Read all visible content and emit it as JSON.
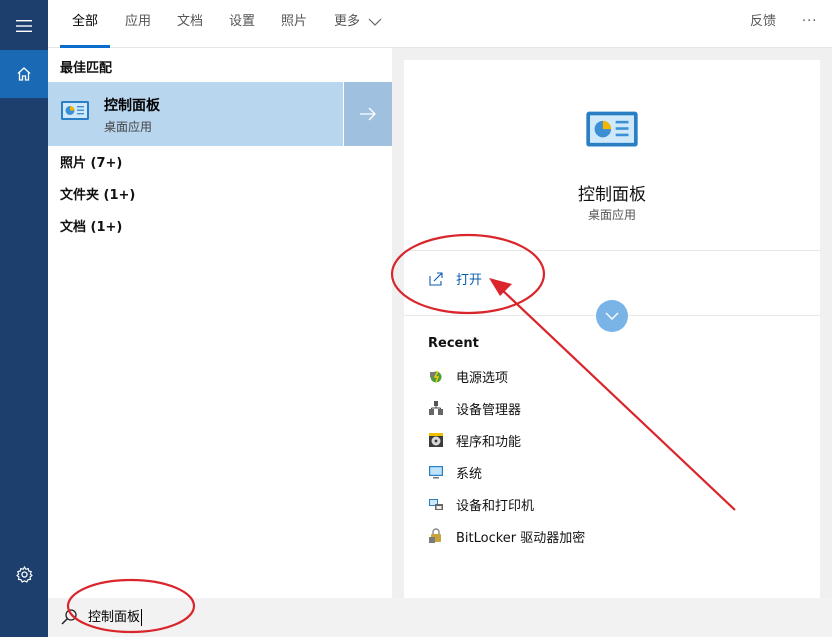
{
  "rail": {
    "items": [
      {
        "name": "menu",
        "icon": "hamburger-icon"
      },
      {
        "name": "home",
        "icon": "home-icon",
        "active": true
      },
      {
        "name": "settings",
        "icon": "gear-icon"
      }
    ]
  },
  "header": {
    "tabs": [
      {
        "label": "全部",
        "active": true
      },
      {
        "label": "应用"
      },
      {
        "label": "文档"
      },
      {
        "label": "设置"
      },
      {
        "label": "照片"
      },
      {
        "label": "更多"
      }
    ],
    "feedback": "反馈",
    "more_options": "···"
  },
  "results": {
    "best_match_label": "最佳匹配",
    "best_match": {
      "title": "控制面板",
      "subtitle": "桌面应用",
      "icon": "control-panel-icon"
    },
    "categories": [
      {
        "label": "照片 (7+)"
      },
      {
        "label": "文件夹 (1+)"
      },
      {
        "label": "文档 (1+)"
      }
    ]
  },
  "detail": {
    "title": "控制面板",
    "subtitle": "桌面应用",
    "open_label": "打开",
    "recent_label": "Recent",
    "recent": [
      {
        "label": "电源选项",
        "icon": "power-options-icon"
      },
      {
        "label": "设备管理器",
        "icon": "device-manager-icon"
      },
      {
        "label": "程序和功能",
        "icon": "programs-features-icon"
      },
      {
        "label": "系统",
        "icon": "system-icon"
      },
      {
        "label": "设备和打印机",
        "icon": "devices-printers-icon"
      },
      {
        "label": "BitLocker 驱动器加密",
        "icon": "bitlocker-icon"
      }
    ]
  },
  "search": {
    "value": "控制面板"
  },
  "colors": {
    "accent": "#0a6ccc",
    "rail": "#1c3f6e",
    "selection": "#b9d6ef",
    "annotation": "#d9252b"
  }
}
